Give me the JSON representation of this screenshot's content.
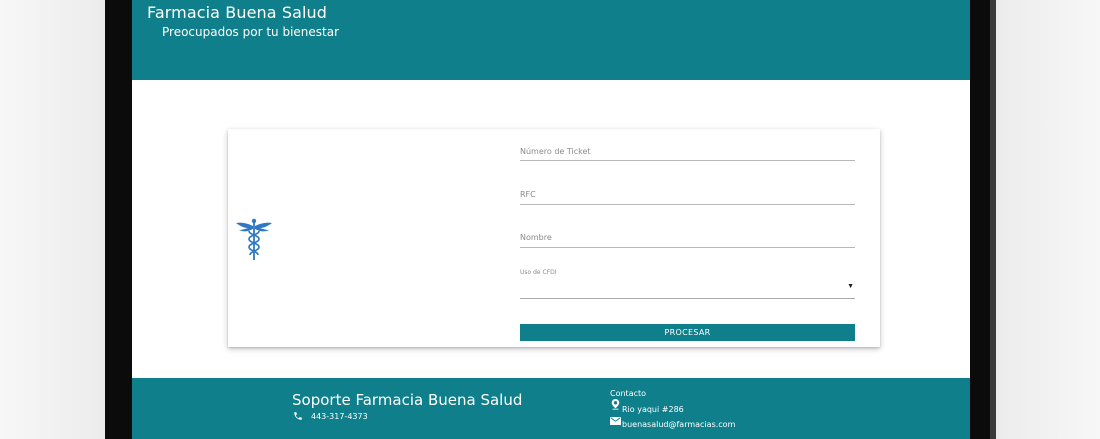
{
  "app": {
    "title": "Farmacia Buena Salud",
    "tagline": "Preocupados por tu bienestar"
  },
  "form": {
    "ticket_label": "Número de Ticket",
    "rfc_label": "RFC",
    "nombre_label": "Nombre",
    "uso_cfdi_label": "Uso de CFDI",
    "submit_label": "PROCESAR"
  },
  "footer": {
    "support_title": "Soporte Farmacia Buena Salud",
    "phone": "443-317-4373",
    "contact_title": "Contacto",
    "address": "Rio yaqui #286",
    "email": "buenasalud@farmacias.com"
  },
  "icons": {
    "logo": "caduceus-icon",
    "phone": "phone-icon",
    "location": "location-pin-icon",
    "email": "mail-icon",
    "select": "dropdown-arrow-icon"
  },
  "colors": {
    "primary": "#0e7f8b",
    "logo": "#2f78c4"
  }
}
